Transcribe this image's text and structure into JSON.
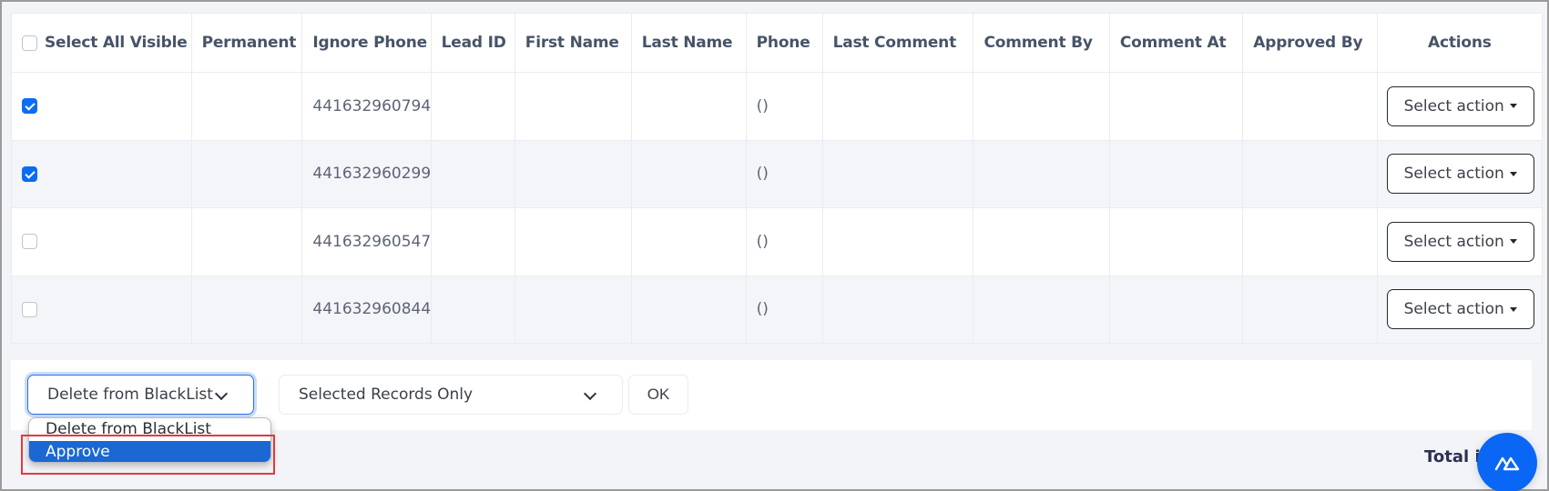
{
  "table": {
    "columns": [
      "Select All Visible",
      "Permanent",
      "Ignore Phone",
      "Lead ID",
      "First Name",
      "Last Name",
      "Phone",
      "Last Comment",
      "Comment By",
      "Comment At",
      "Approved By",
      "Actions"
    ],
    "select_all_checked": false,
    "rows": [
      {
        "checked": true,
        "permanent": "",
        "ignore_phone": "441632960794",
        "lead_id": "",
        "first_name": "",
        "last_name": "",
        "phone": "()",
        "last_comment": "",
        "comment_by": "",
        "comment_at": "",
        "approved_by": "",
        "action_label": "Select action"
      },
      {
        "checked": true,
        "permanent": "",
        "ignore_phone": "441632960299",
        "lead_id": "",
        "first_name": "",
        "last_name": "",
        "phone": "()",
        "last_comment": "",
        "comment_by": "",
        "comment_at": "",
        "approved_by": "",
        "action_label": "Select action"
      },
      {
        "checked": false,
        "permanent": "",
        "ignore_phone": "441632960547",
        "lead_id": "",
        "first_name": "",
        "last_name": "",
        "phone": "()",
        "last_comment": "",
        "comment_by": "",
        "comment_at": "",
        "approved_by": "",
        "action_label": "Select action"
      },
      {
        "checked": false,
        "permanent": "",
        "ignore_phone": "441632960844",
        "lead_id": "",
        "first_name": "",
        "last_name": "",
        "phone": "()",
        "last_comment": "",
        "comment_by": "",
        "comment_at": "",
        "approved_by": "",
        "action_label": "Select action"
      }
    ]
  },
  "bulk_actions": {
    "action_select": {
      "value": "Delete from BlackList",
      "options": [
        "Delete from BlackList",
        "Approve"
      ],
      "highlighted_option": "Approve",
      "open": true
    },
    "scope_select": {
      "value": "Selected Records Only"
    },
    "ok_label": "OK"
  },
  "footer": {
    "total_label": "Total it"
  },
  "fab": {
    "icon": "logo-triangles-icon",
    "color": "#0a66f5"
  },
  "colors": {
    "accent": "#0b6cf5",
    "highlight_box": "#e4393d",
    "dropdown_active": "#1b67d3"
  }
}
